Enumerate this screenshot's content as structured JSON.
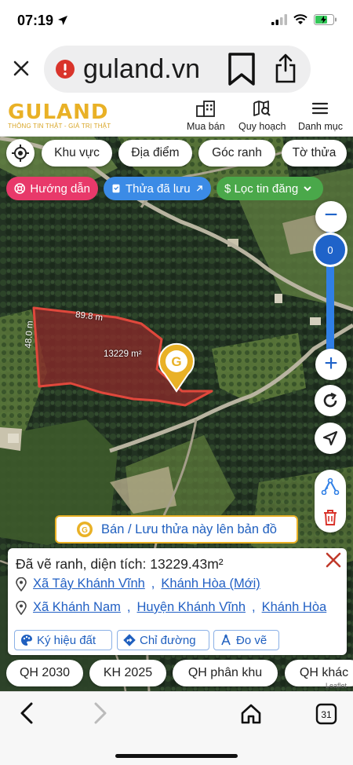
{
  "status": {
    "time": "07:19"
  },
  "browser": {
    "url": "guland.vn"
  },
  "site": {
    "logo": "GULAND",
    "tagline": "THÔNG TIN THẬT - GIÁ TRỊ THẬT",
    "nav": [
      {
        "label": "Mua bán",
        "icon": "buildings-icon"
      },
      {
        "label": "Quy hoạch",
        "icon": "map-search-icon"
      },
      {
        "label": "Danh mục",
        "icon": "hamburger-menu-icon"
      }
    ]
  },
  "map_controls": {
    "filters": [
      "Khu vực",
      "Địa điểm",
      "Góc ranh",
      "Tờ thửa"
    ],
    "guide_label": "Hướng dẫn",
    "saved_label": "Thửa đã lưu",
    "filter_label": "$ Lọc tin đăng",
    "zoom_level": "0",
    "zoom_in": "+",
    "zoom_out": "−"
  },
  "parcel": {
    "top_edge": "89.8 m",
    "left_edge": "48.0 m",
    "area_label": "13229 m²"
  },
  "save_button_label": "Bán / Lưu thửa này lên bản đồ",
  "info": {
    "title": "Đã vẽ ranh, diện tích: 13229.43m²",
    "address_new": [
      "Xã Tây Khánh Vĩnh",
      "Khánh Hòa (Mới)"
    ],
    "address_old": [
      "Xã Khánh Nam",
      "Huyện Khánh Vĩnh",
      "Khánh Hòa"
    ],
    "buttons": [
      "Ký hiệu đất",
      "Chỉ đường",
      "Đo vẽ"
    ]
  },
  "planning_tabs": [
    "QH 2030",
    "KH 2025",
    "QH phân khu",
    "QH khác"
  ],
  "attribution": "Leaflet",
  "colors": {
    "brand_gold": "#e9b126",
    "guide_pink": "#e8396a",
    "saved_blue": "#3b8be6",
    "filter_green": "#4aa84a",
    "parcel_red": "#e0483c",
    "link_blue": "#2260c4"
  }
}
